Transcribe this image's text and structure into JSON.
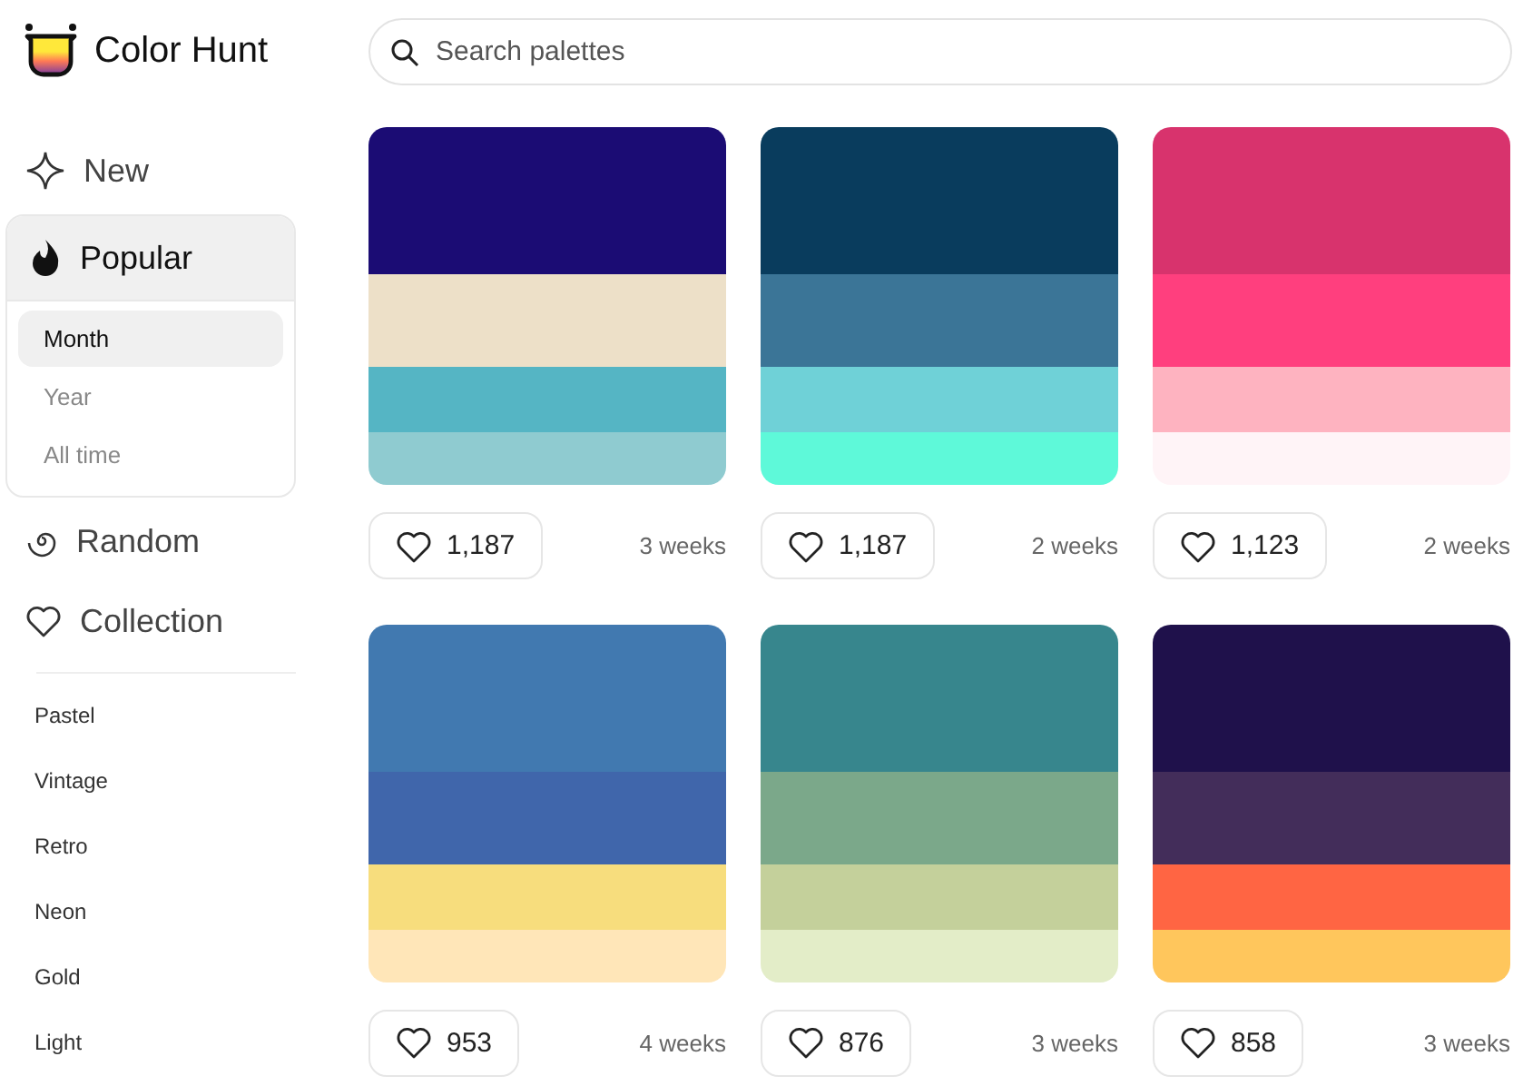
{
  "brand": {
    "name": "Color Hunt"
  },
  "search": {
    "placeholder": "Search palettes"
  },
  "nav": [
    {
      "kind": "new",
      "label": "New",
      "selected": false
    },
    {
      "kind": "popular",
      "label": "Popular",
      "selected": true,
      "expanded": true,
      "children": [
        {
          "label": "Month",
          "selected": true
        },
        {
          "label": "Year",
          "selected": false
        },
        {
          "label": "All time",
          "selected": false
        }
      ]
    },
    {
      "kind": "random",
      "label": "Random",
      "selected": false
    },
    {
      "kind": "collection",
      "label": "Collection",
      "selected": false
    }
  ],
  "tags": [
    "Pastel",
    "Vintage",
    "Retro",
    "Neon",
    "Gold",
    "Light"
  ],
  "palettes": [
    {
      "swatches": [
        {
          "color": "#1b0c74"
        },
        {
          "color": "#ede0c8"
        },
        {
          "color": "#55b5c4"
        },
        {
          "color": "#8fcbd0"
        }
      ],
      "likes": "1,187",
      "age": "3 weeks"
    },
    {
      "swatches": [
        {
          "color": "#093c5d"
        },
        {
          "color": "#3b7597"
        },
        {
          "color": "#6fd1d7"
        },
        {
          "color": "#5ef9d9"
        }
      ],
      "likes": "1,187",
      "age": "2 weeks"
    },
    {
      "swatches": [
        {
          "color": "#d8336d"
        },
        {
          "color": "#ff3f7e"
        },
        {
          "color": "#feb3c0"
        },
        {
          "color": "#fff4f7"
        }
      ],
      "likes": "1,123",
      "age": "2 weeks"
    },
    {
      "swatches": [
        {
          "color": "#4179b0"
        },
        {
          "color": "#4066ab"
        },
        {
          "color": "#f7dd7d"
        },
        {
          "color": "#ffe6b8"
        }
      ],
      "likes": "953",
      "age": "4 weeks"
    },
    {
      "swatches": [
        {
          "color": "#37868d"
        },
        {
          "color": "#7ba88a"
        },
        {
          "color": "#c4d09b"
        },
        {
          "color": "#e3edc8"
        }
      ],
      "likes": "876",
      "age": "3 weeks"
    },
    {
      "swatches": [
        {
          "color": "#1f114b"
        },
        {
          "color": "#432d5a"
        },
        {
          "color": "#ff6543"
        },
        {
          "color": "#ffc65c"
        }
      ],
      "likes": "858",
      "age": "3 weeks"
    }
  ]
}
